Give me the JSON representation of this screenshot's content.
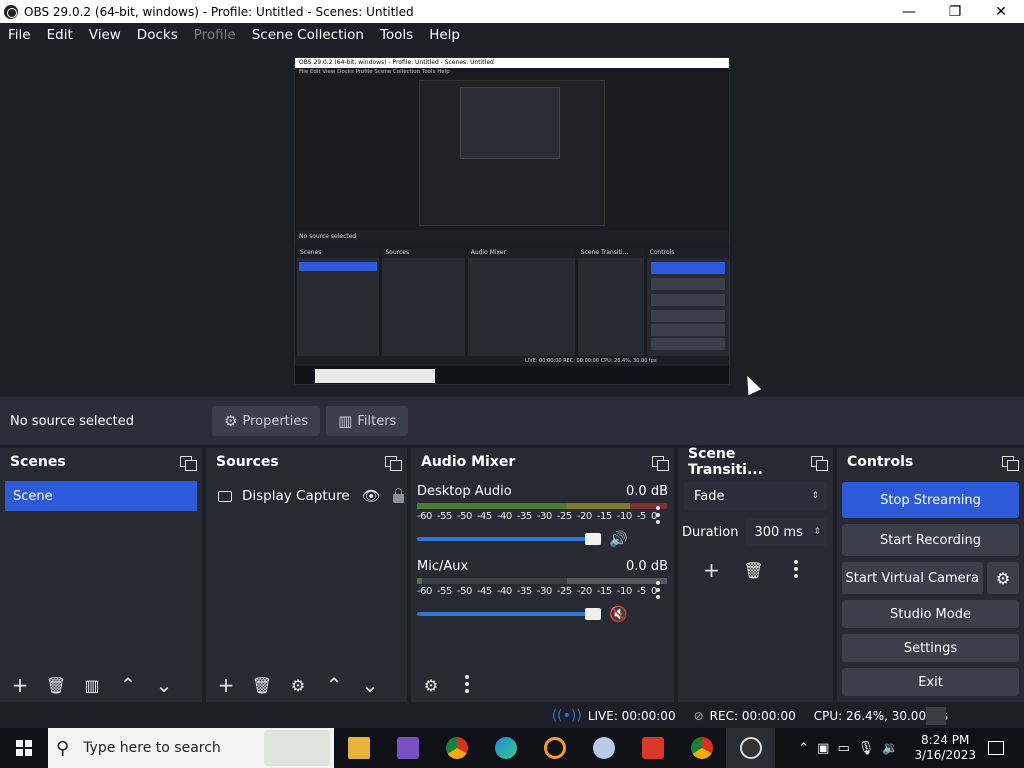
{
  "window": {
    "title": "OBS 29.0.2 (64-bit, windows) - Profile: Untitled - Scenes: Untitled",
    "minimize": "—",
    "maximize": "❐",
    "close": "✕"
  },
  "menu": [
    "File",
    "Edit",
    "View",
    "Docks",
    "Profile",
    "Scene Collection",
    "Tools",
    "Help"
  ],
  "preview": {
    "mini_title": "OBS 29.0.2 (64-bit, windows) - Profile: Untitled - Scenes: Untitled",
    "mini_menu": "File  Edit  View  Docks  Profile  Scene Collection  Tools  Help",
    "mini_nosel": "No source selected",
    "mini_panels": [
      "Scenes",
      "Sources",
      "Audio Mixer",
      "Scene Transiti...",
      "Controls"
    ],
    "mini_status": "LIVE: 00:00:00   REC: 00:00:00   CPU: 26.4%, 30.00 fps",
    "mini_search": "Type here to search",
    "mini_buttons": [
      "Stop Streaming",
      "Start Recording",
      "Start Virtual Camera",
      "Studio Mode",
      "Settings",
      "Exit"
    ]
  },
  "source_toolbar": {
    "status": "No source selected",
    "properties": "Properties",
    "filters": "Filters"
  },
  "scenes": {
    "title": "Scenes",
    "items": [
      "Scene"
    ]
  },
  "sources": {
    "title": "Sources",
    "items": [
      "Display Capture"
    ]
  },
  "mixer": {
    "title": "Audio Mixer",
    "ticks": [
      "-60",
      "-55",
      "-50",
      "-45",
      "-40",
      "-35",
      "-30",
      "-25",
      "-20",
      "-15",
      "-10",
      "-5",
      "0"
    ],
    "channels": [
      {
        "name": "Desktop Audio",
        "level": "0.0 dB",
        "volume": 1.0,
        "muted": false
      },
      {
        "name": "Mic/Aux",
        "level": "0.0 dB",
        "volume": 1.0,
        "muted": true
      }
    ]
  },
  "transitions": {
    "title": "Scene Transiti...",
    "selected": "Fade",
    "duration_label": "Duration",
    "duration_value": "300 ms"
  },
  "controls": {
    "title": "Controls",
    "stop_streaming": "Stop Streaming",
    "start_recording": "Start Recording",
    "start_virtual_camera": "Start Virtual Camera",
    "studio_mode": "Studio Mode",
    "settings": "Settings",
    "exit": "Exit"
  },
  "status": {
    "live": "LIVE: 00:00:00",
    "rec": "REC: 00:00:00",
    "cpu": "CPU: 26.4%, 30.00 fps"
  },
  "taskbar": {
    "search_placeholder": "Type here to search",
    "time": "8:24 PM",
    "date": "3/16/2023"
  },
  "colors": {
    "accent": "#2c5ad8",
    "panel": "#272a33",
    "background": "#1d1f26"
  }
}
